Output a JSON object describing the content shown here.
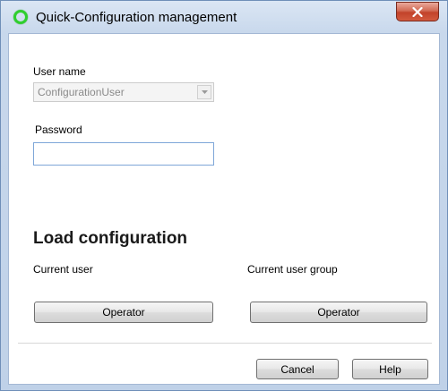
{
  "window": {
    "title": "Quick-Configuration management",
    "close_label": "x"
  },
  "login": {
    "username_label": "User name",
    "username_value": "ConfigurationUser",
    "username_enabled": false,
    "password_label": "Password",
    "password_value": ""
  },
  "load": {
    "section_title": "Load configuration",
    "current_user_label": "Current user",
    "current_user_button": "Operator",
    "current_group_label": "Current user group",
    "current_group_button": "Operator"
  },
  "footer": {
    "cancel_label": "Cancel",
    "help_label": "Help"
  },
  "colors": {
    "title_gradient_top": "#dbe6f4",
    "close_button": "#c2432a",
    "app_icon": "#2fcf2f",
    "input_focus_border": "#7ea6d8"
  },
  "icons": {
    "app": "green-ring-icon",
    "close": "close-icon",
    "dropdown": "chevron-down-icon"
  }
}
